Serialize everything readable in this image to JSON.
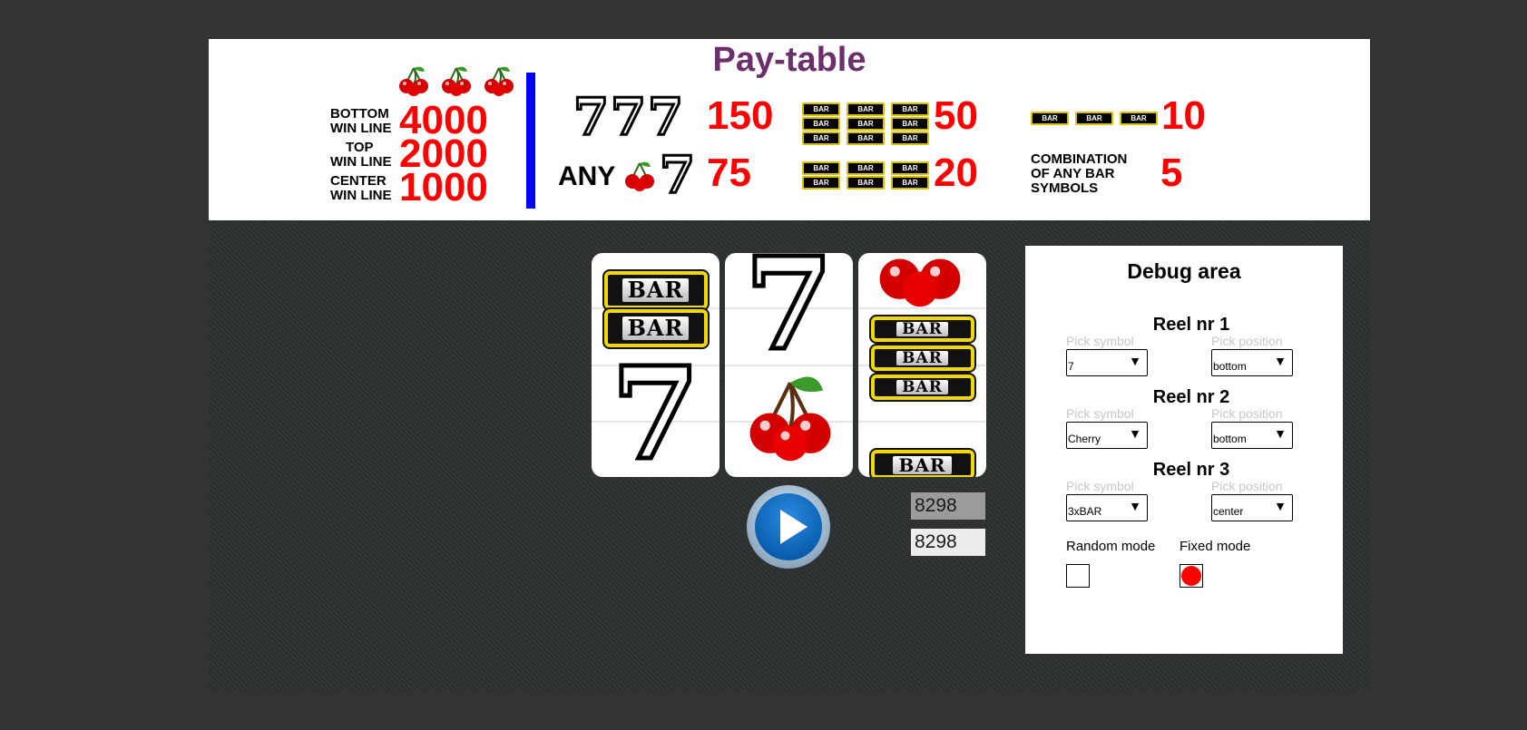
{
  "paytable": {
    "title": "Pay-table",
    "bottom_label_1": "BOTTOM",
    "bottom_label_2": "WIN LINE",
    "bottom_value": "4000",
    "top_label_1": "TOP",
    "top_label_2": "WIN LINE",
    "top_value": "2000",
    "center_label_1": "CENTER",
    "center_label_2": "WIN LINE",
    "center_value": "1000",
    "three_sevens_value": "150",
    "three_3xbar_value": "50",
    "three_bar_value": "10",
    "any_label": "ANY",
    "any_cherry_seven_value": "75",
    "three_2xbar_value": "20",
    "combo_label_1": "COMBINATION",
    "combo_label_2": "OF ANY BAR",
    "combo_label_3": "SYMBOLS",
    "combo_value": "5",
    "mini_bar_text": "BAR",
    "seven_glyph": "7"
  },
  "reels": {
    "bar_text": "BAR",
    "seven_glyph": "7",
    "reel1": [
      "2xBAR",
      "7"
    ],
    "reel2": [
      "7",
      "Cherry"
    ],
    "reel3": [
      "Cherry",
      "3xBAR",
      "BAR"
    ]
  },
  "credits": {
    "value_1": "8298",
    "value_2": "8298"
  },
  "debug": {
    "title": "Debug area",
    "reel1_title": "Reel nr 1",
    "reel2_title": "Reel nr 2",
    "reel3_title": "Reel nr 3",
    "pick_symbol_label": "Pick symbol",
    "pick_position_label": "Pick position",
    "reel1_symbol": "7",
    "reel1_position": "bottom",
    "reel2_symbol": "Cherry",
    "reel2_position": "bottom",
    "reel3_symbol": "3xBAR",
    "reel3_position": "center",
    "random_mode_label": "Random mode",
    "fixed_mode_label": "Fixed mode",
    "random_mode_checked": false,
    "fixed_mode_checked": true
  },
  "colors": {
    "background": "#333333",
    "title_purple": "#6b2f6b",
    "payout_red": "#ff0000",
    "divider_blue": "#0000ff",
    "bar_gold": "#f0d800",
    "spin_blue": "#0a5fb0"
  }
}
